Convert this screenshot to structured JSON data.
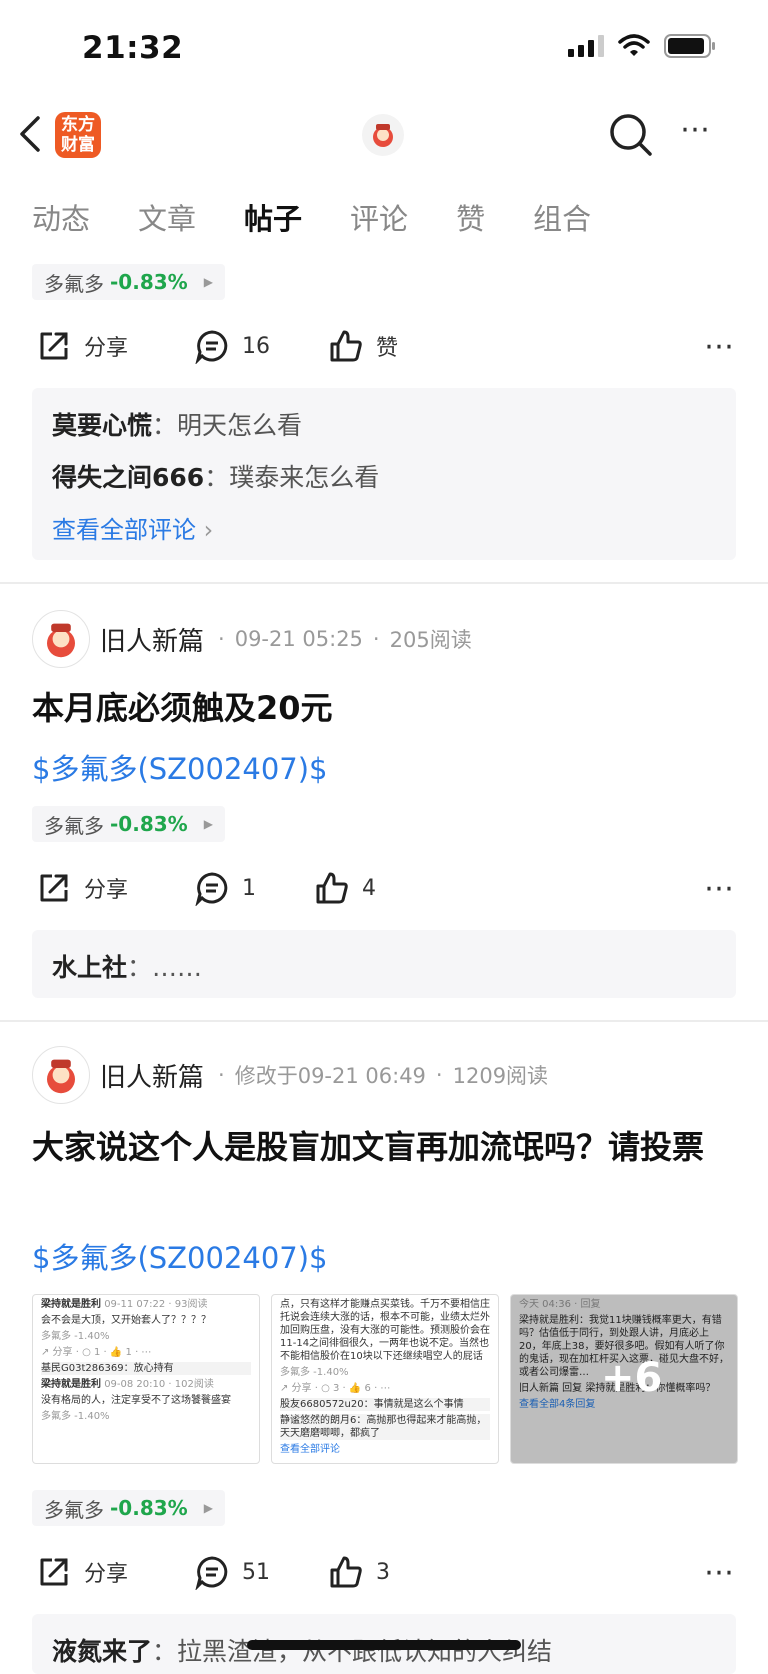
{
  "status": {
    "time": "21:32"
  },
  "header": {
    "logo_text": "东方\n财富",
    "logo_line1": "东方",
    "logo_line2": "财富"
  },
  "tabs": [
    {
      "label": "动态"
    },
    {
      "label": "文章"
    },
    {
      "label": "帖子"
    },
    {
      "label": "评论"
    },
    {
      "label": "赞"
    },
    {
      "label": "组合"
    }
  ],
  "active_tab": "帖子",
  "stock": {
    "name": "多氟多",
    "change": "-0.83%"
  },
  "post0": {
    "share": "分享",
    "comments": "16",
    "likes": "赞",
    "comment_list": [
      {
        "user": "莫要心慌",
        "text": "明天怎么看"
      },
      {
        "user": "得失之间666",
        "text": "璞泰来怎么看"
      }
    ],
    "view_all": "查看全部评论"
  },
  "post1": {
    "author": "旧人新篇",
    "time": "09-21 05:25",
    "reads": "205阅读",
    "title": "本月底必须触及20元",
    "tag": "$多氟多(SZ002407)$",
    "share": "分享",
    "comments": "1",
    "likes": "4",
    "comment_list": [
      {
        "user": "水上社",
        "text": "……"
      }
    ]
  },
  "post2": {
    "author": "旧人新篇",
    "time": "修改于09-21 06:49",
    "reads": "1209阅读",
    "title": "大家说这个人是股盲加文盲再加流氓吗？请投票",
    "tag": "$多氟多(SZ002407)$",
    "more_images": "+6",
    "share": "分享",
    "comments": "51",
    "likes": "3",
    "comment_list": [
      {
        "user": "液氮来了",
        "text": "拉黑渣渣，从不跟低认知的人纠结"
      }
    ]
  },
  "thumb1": {
    "u1": "梁持就是胜利",
    "t1": "09-11 07:22 · 93阅读",
    "m1": "会不会是大顶，又开始套人了？？？？",
    "s1": "多氟多 -1.40%",
    "c1": "基民G03t286369：放心持有",
    "u2": "梁持就是胜利",
    "t2": "09-08 20:10 · 102阅读",
    "m2": "没有格局的人，注定享受不了这场饕餮盛宴",
    "s2": "多氟多 -1.40%"
  },
  "thumb2": {
    "m1": "点，只有这样才能赚点买菜钱。千万不要相信庄托说会连续大涨的话，根本不可能，业绩太烂外加回购压盘，没有大涨的可能性。预测股价会在11-14之间徘徊很久，一两年也说不定。当然也不能相信股价在10块以下还继续唱空人的屁话",
    "s1": "多氟多 -1.40%",
    "c1": "股友6680572u20：事情就是这么个事情",
    "c2": "静谧悠然的朗月6：高抛那也得起来才能高抛，天天磨磨唧唧，都疯了",
    "v": "查看全部评论"
  },
  "thumb3": {
    "m1": "今天 04:36 · 回复",
    "m2": "梁持就是胜利：我觉11块赚钱概率更大，有错吗？估值低于同行，到处跟人讲，月底必上20，年底上38，要好很多吧。假如有人听了你的鬼话，现在加杠杆买入这票，碰见大盘不好，或者公司爆雷…",
    "m3": "旧人新篇 回复 梁持就是胜利：你懂概率吗？",
    "v": "查看全部4条回复"
  }
}
